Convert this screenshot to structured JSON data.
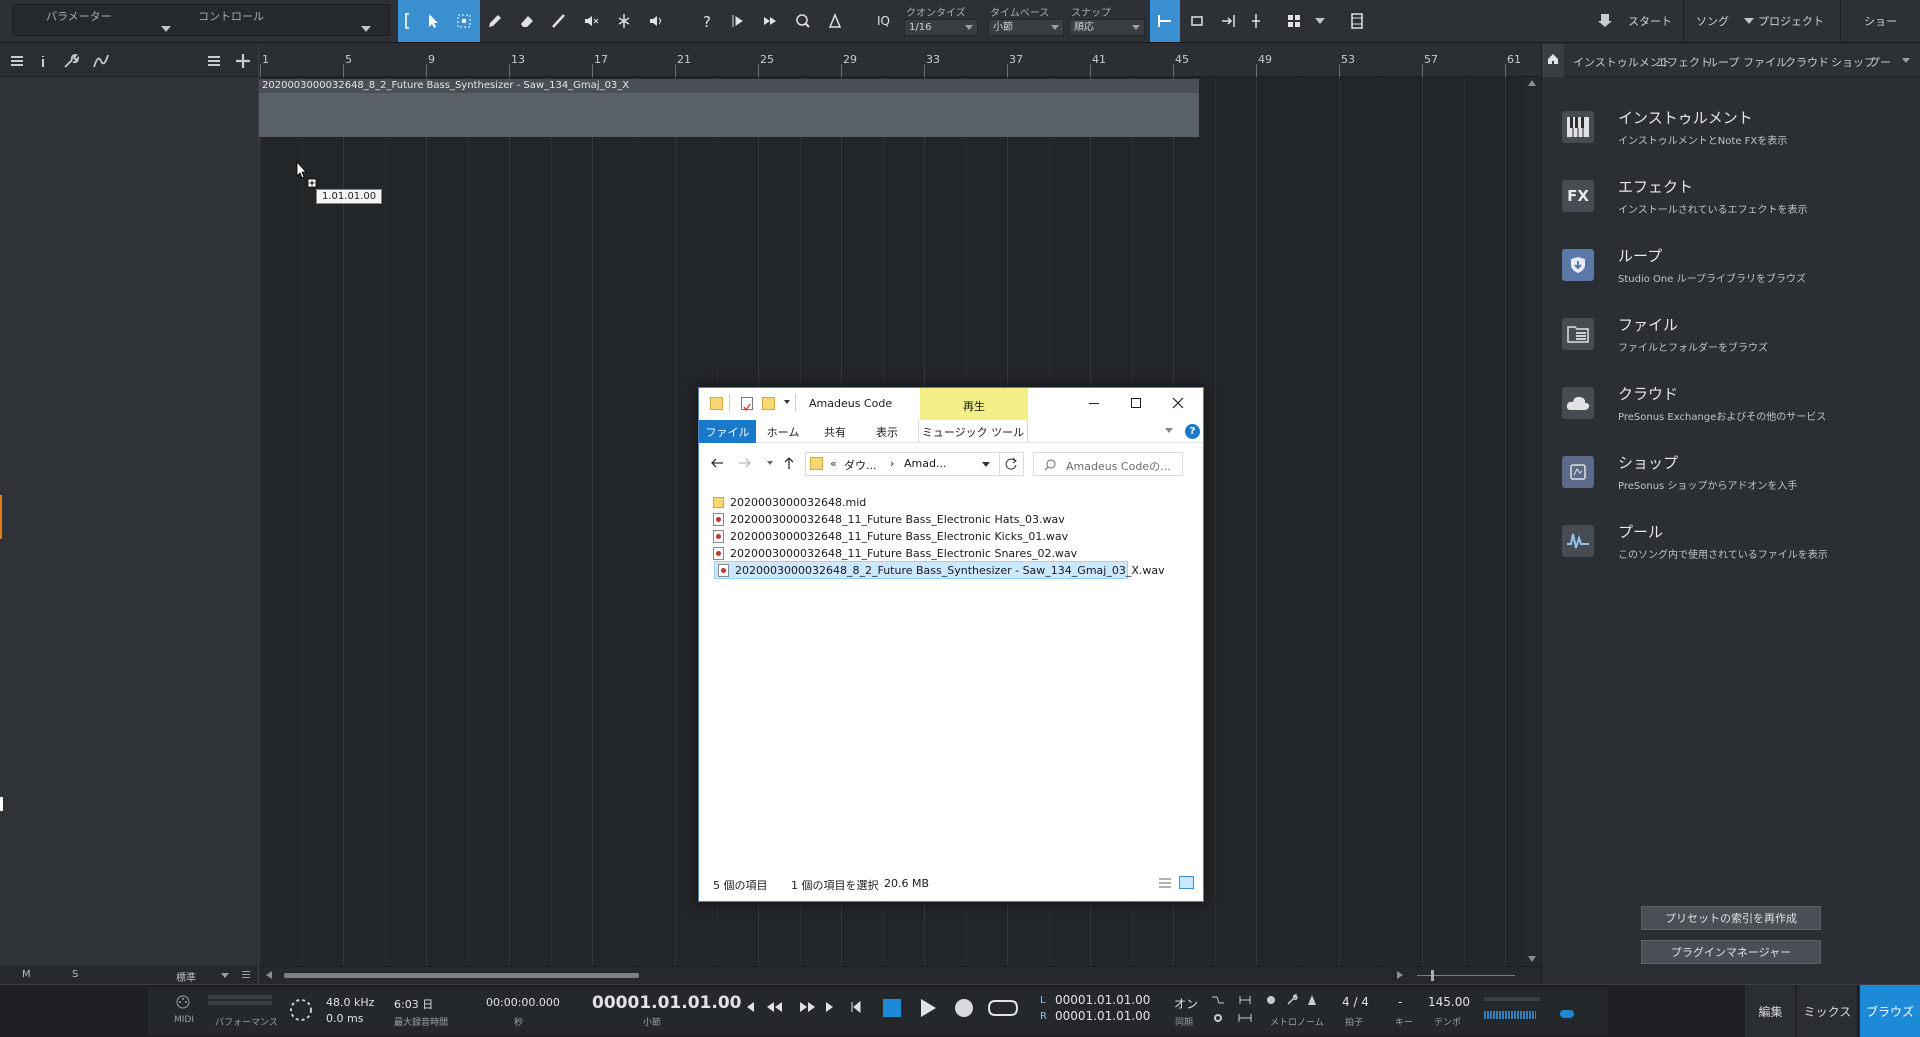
{
  "toolbar": {
    "param_label": "パラメーター",
    "control_label": "コントロール",
    "iq_label": "IQ",
    "quantize_label": "クオンタイズ",
    "quantize_value": "1/16",
    "timebase_label": "タイムベース",
    "timebase_value": "小節",
    "snap_label": "スナップ",
    "snap_value": "順応",
    "start_label": "スタート",
    "song_label": "ソング",
    "project_label": "プロジェクト",
    "show_label": "ショー"
  },
  "left_footer": {
    "m_label": "M",
    "s_label": "S",
    "mode_label": "標準"
  },
  "ruler": {
    "bars": [
      "1",
      "5",
      "9",
      "13",
      "17",
      "21",
      "25",
      "29",
      "33",
      "37",
      "41",
      "45",
      "49",
      "53",
      "57",
      "61"
    ]
  },
  "clip": {
    "name": "2020003000032648_8_2_Future Bass_Synthesizer - Saw_134_Gmaj_03_X"
  },
  "tooltip": {
    "position": "1.01.01.00"
  },
  "browser": {
    "tabs": [
      "インストゥルメント",
      "エフェクト",
      "ループ",
      "ファイル",
      "クラウド",
      "ショップ",
      "プー"
    ],
    "items": [
      {
        "title": "インストゥルメント",
        "sub": "インストゥルメントとNote FXを表示",
        "icon": "piano-icon"
      },
      {
        "title": "エフェクト",
        "sub": "インストールされているエフェクトを表示",
        "icon": "fx-icon",
        "glyph": "FX"
      },
      {
        "title": "ループ",
        "sub": "Studio One ループライブラリをブラウズ",
        "icon": "loop-icon"
      },
      {
        "title": "ファイル",
        "sub": "ファイルとフォルダーをブラウズ",
        "icon": "files-icon"
      },
      {
        "title": "クラウド",
        "sub": "PreSonus Exchangeおよびその他のサービス",
        "icon": "cloud-icon"
      },
      {
        "title": "ショップ",
        "sub": "PreSonus ショップからアドオンを入手",
        "icon": "shop-icon"
      },
      {
        "title": "プール",
        "sub": "このソング内で使用されているファイルを表示",
        "icon": "pool-icon"
      }
    ],
    "btn_reindex": "プリセットの索引を再作成",
    "btn_plugin_mgr": "プラグインマネージャー"
  },
  "transport": {
    "midi_label": "MIDI",
    "perf_label": "パフォーマンス",
    "sample_rate": "48.0 kHz",
    "latency": "0.0 ms",
    "rec_days": "6:03 日",
    "rec_label": "最大録音時間",
    "time_seconds": "00:00:00.000",
    "seconds_label": "秒",
    "position": "00001.01.01.00",
    "position_label": "小節",
    "loop_l": "00001.01.01.00",
    "loop_r": "00001.01.01.00",
    "l_label": "L",
    "r_label": "R",
    "sync_value": "オン",
    "sync_label": "同期",
    "metronome_label": "メトロノーム",
    "timesig": "4 / 4",
    "timesig_label": "拍子",
    "key_value": "-",
    "key_label": "キー",
    "tempo": "145.00",
    "tempo_label": "テンポ",
    "page_edit": "編集",
    "page_mix": "ミックス",
    "page_browse": "ブラウズ"
  },
  "explorer": {
    "title": "Amadeus Code",
    "ribbon_context": "再生",
    "tabs": [
      "ファイル",
      "ホーム",
      "共有",
      "表示",
      "ミュージック ツール"
    ],
    "breadcrumb_prefix": "«",
    "breadcrumb_1": "ダウ...",
    "breadcrumb_sep": "›",
    "breadcrumb_2": "Amad...",
    "search_placeholder": "Amadeus Codeの...",
    "files": [
      {
        "name": "2020003000032648.mid",
        "type": "folder"
      },
      {
        "name": "2020003000032648_11_Future Bass_Electronic Hats_03.wav",
        "type": "wav"
      },
      {
        "name": "2020003000032648_11_Future Bass_Electronic Kicks_01.wav",
        "type": "wav"
      },
      {
        "name": "2020003000032648_11_Future Bass_Electronic Snares_02.wav",
        "type": "wav"
      },
      {
        "name": "2020003000032648_8_2_Future Bass_Synthesizer - Saw_134_Gmaj_03_X.wav",
        "type": "wav",
        "selected": true
      }
    ],
    "status_count": "5 個の項目",
    "status_selected": "1 個の項目を選択",
    "status_size": "20.6 MB"
  },
  "colors": {
    "accent": "#1c8ad6",
    "toolbar_active": "#3a8fd0",
    "ribbon_context": "#f3f089"
  }
}
